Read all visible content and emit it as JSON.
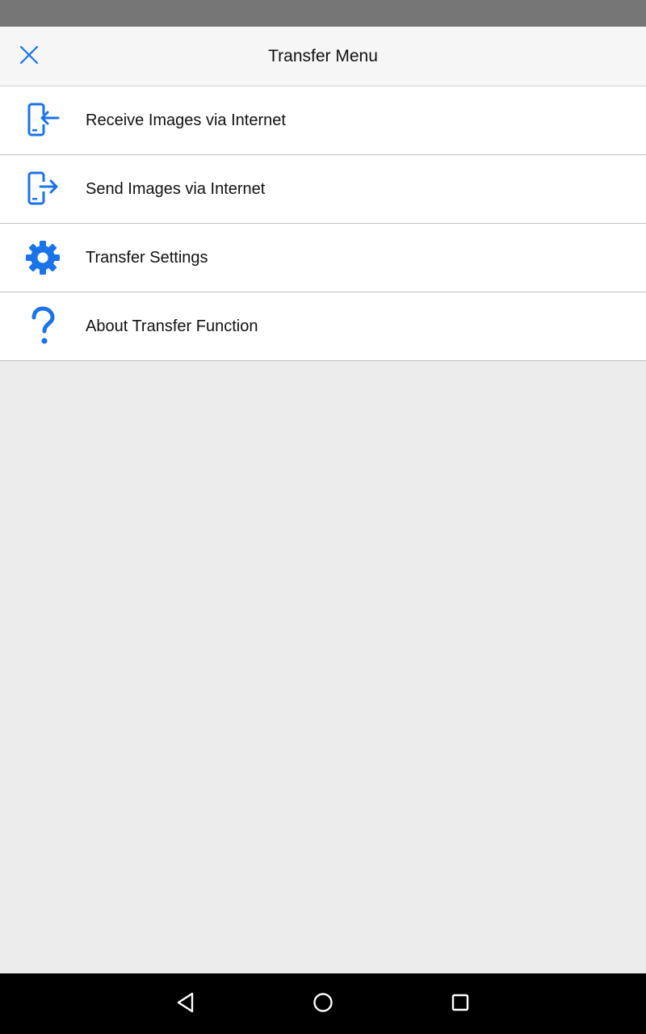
{
  "header": {
    "title": "Transfer Menu",
    "close_icon": "close-icon"
  },
  "menu": {
    "items": [
      {
        "label": "Receive Images via Internet",
        "icon": "phone-receive-icon"
      },
      {
        "label": "Send Images via Internet",
        "icon": "phone-send-icon"
      },
      {
        "label": "Transfer Settings",
        "icon": "gear-icon"
      },
      {
        "label": "About Transfer Function",
        "icon": "question-icon"
      }
    ]
  },
  "navbar": {
    "back_icon": "back-triangle-icon",
    "home_icon": "home-circle-icon",
    "recents_icon": "recents-square-icon"
  },
  "colors": {
    "accent": "#1a73e8",
    "status_bar": "#767676",
    "header_bg": "#f6f6f6",
    "content_bg": "#ececec",
    "nav_bg": "#000000"
  }
}
